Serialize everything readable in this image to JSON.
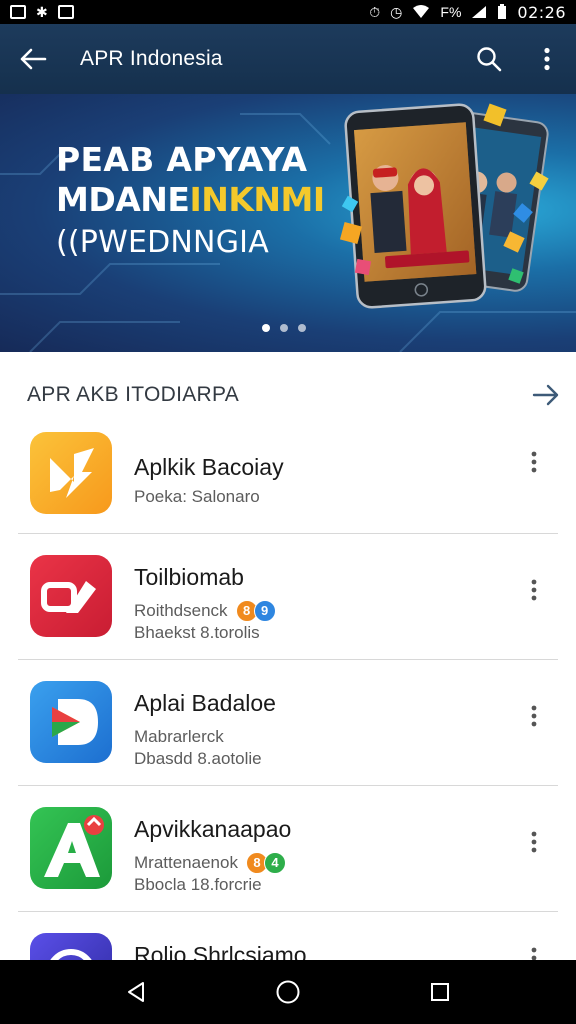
{
  "status_bar": {
    "time": "02:26",
    "battery_text": "F%"
  },
  "app_bar": {
    "title": "APR Indonesia",
    "icons": [
      "back-arrow-icon",
      "search-icon",
      "more-vert-icon"
    ]
  },
  "banner": {
    "line1": "PEAB APYAYA",
    "line2_white": "MDANE",
    "line2_highlight": "INKNMI",
    "line3": "((PWEDNNGIA",
    "photo_caption": "",
    "dots_count": 3,
    "active_dot": 0
  },
  "section": {
    "title": "APR AKB ITODIARPA",
    "arrow_icon": "arrow-right-icon"
  },
  "apps": [
    {
      "name": "Aplkik Bacoiay",
      "line1": "Poeka: Salonaro",
      "line2": "",
      "badges": [],
      "icon": "lightning-n-icon",
      "icon_colors": [
        "#f7a21c",
        "#fbc33a"
      ]
    },
    {
      "name": "Toilbiomab",
      "line1": "Roithdsenck",
      "line2": "Bhaekst 8.torolis",
      "badges": [
        {
          "text": "8",
          "color": "#f08a1e"
        },
        {
          "text": "9",
          "color": "#2f86e0"
        }
      ],
      "icon": "toggle-share-icon",
      "icon_colors": [
        "#e02a3e",
        "#c91d33"
      ]
    },
    {
      "name": "Aplai Badaloe",
      "line1": "Mabrarlerck",
      "line2": "Dbasdd 8.aotolie",
      "badges": [],
      "icon": "play-d-icon",
      "icon_colors": [
        "#2f95e8",
        "#1d6fd0"
      ]
    },
    {
      "name": "Apvikkanaapao",
      "line1": "Mrattenaenok",
      "line2": "Bbocla 18.forcrie",
      "badges": [
        {
          "text": "8",
          "color": "#f08a1e"
        },
        {
          "text": "4",
          "color": "#2eae4a"
        }
      ],
      "icon": "letter-a-icon",
      "icon_colors": [
        "#27b84a",
        "#1c9a3a"
      ]
    },
    {
      "name": "Rolio Shrlcsiamo",
      "line1": "",
      "line2": "",
      "badges": [],
      "icon": "circle-app-icon",
      "icon_colors": [
        "#4a3fd8",
        "#2e2aa0"
      ]
    }
  ],
  "nav_bar": {
    "icons": [
      "back-triangle-icon",
      "home-circle-icon",
      "recents-square-icon"
    ]
  }
}
